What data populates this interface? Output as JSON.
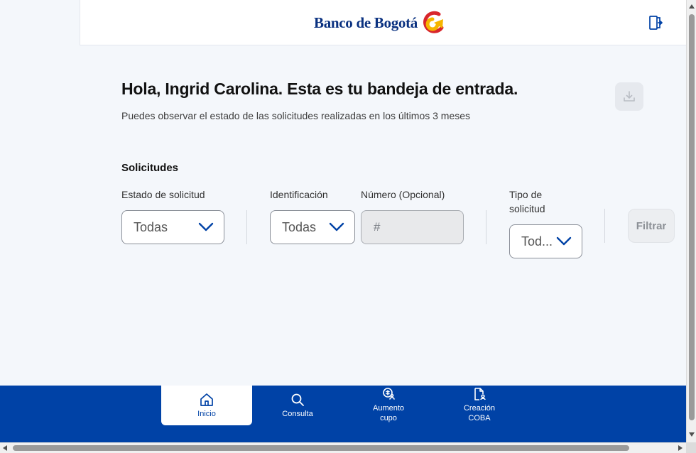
{
  "header": {
    "bank_name": "Banco de Bogotá",
    "logout_icon": "logout-icon"
  },
  "main": {
    "greeting": "Hola, Ingrid Carolina.  Esta es tu bandeja de entrada.",
    "subtitle": "Puedes observar el estado de las solicitudes realizadas en los últimos 3 meses",
    "download_icon": "download-icon"
  },
  "filters": {
    "section_title": "Solicitudes",
    "estado_label": "Estado de solicitud",
    "estado_value": "Todas",
    "identificacion_label": "Identificación",
    "identificacion_value": "Todas",
    "numero_label": "Número (Opcional)",
    "numero_placeholder": "#",
    "tipo_label": "Tipo de solicitud",
    "tipo_value": "Tod...",
    "filter_button": "Filtrar"
  },
  "bottom_nav": {
    "items": [
      {
        "label": "Inicio",
        "icon": "home-icon",
        "active": true
      },
      {
        "label": "Consulta",
        "icon": "search-icon",
        "active": false
      },
      {
        "label": "Aumento cupo",
        "icon": "money-user-icon",
        "active": false
      },
      {
        "label": "Creación COBA",
        "icon": "document-user-icon",
        "active": false
      }
    ]
  },
  "colors": {
    "brand_blue": "#0042a6",
    "logo_blue": "#0a3180",
    "background": "#f4f7fb"
  }
}
